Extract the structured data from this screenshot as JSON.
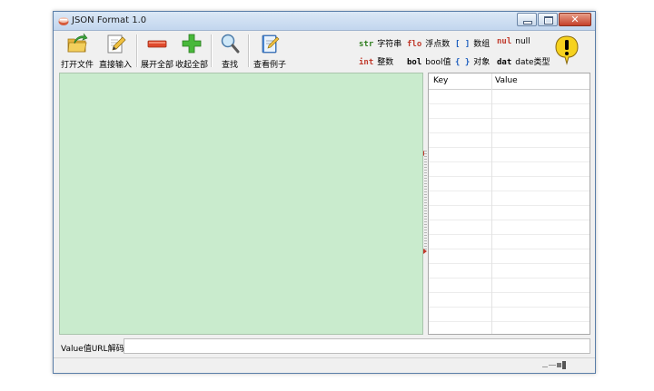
{
  "window": {
    "title": "JSON Format 1.0"
  },
  "toolbar": {
    "open_file": "打开文件",
    "direct_input": "直接输入",
    "expand_all": "展开全部",
    "collapse_all": "收起全部",
    "find": "查找",
    "view_example": "查看例子"
  },
  "legend": [
    {
      "code": "str",
      "label": "字符串",
      "color": "#2e7d1e"
    },
    {
      "code": "flo",
      "label": "浮点数",
      "color": "#c0392b"
    },
    {
      "code": "[ ]",
      "label": "数组",
      "color": "#1f5fbf"
    },
    {
      "code": "nul",
      "label": "null",
      "color": "#c0392b"
    },
    {
      "code": "int",
      "label": "整数",
      "color": "#c0392b"
    },
    {
      "code": "bol",
      "label": "bool值",
      "color": "#000000"
    },
    {
      "code": "{ }",
      "label": "对象",
      "color": "#1f5fbf"
    },
    {
      "code": "dat",
      "label": "date类型",
      "color": "#000000"
    }
  ],
  "grid": {
    "col_key": "Key",
    "col_value": "Value"
  },
  "bottom": {
    "label": "Value值URL解码",
    "value": ""
  },
  "colors": {
    "editor_bg": "#c9ebcd",
    "window_bg": "#f0f0f0"
  }
}
